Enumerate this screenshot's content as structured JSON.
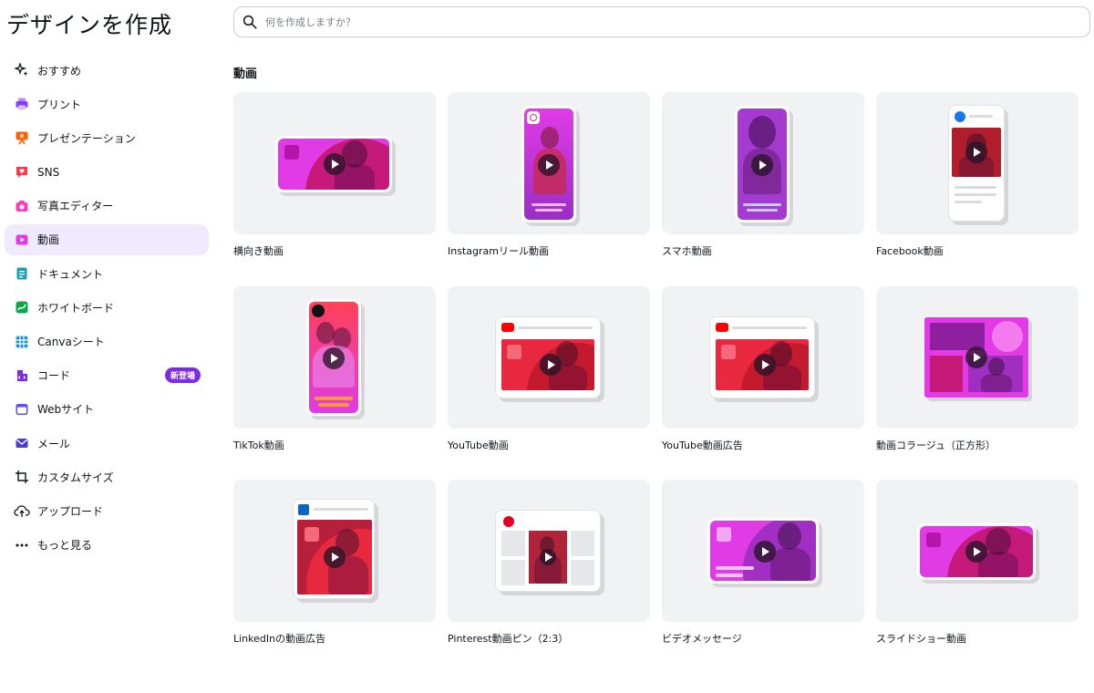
{
  "app": {
    "title": "デザインを作成"
  },
  "search": {
    "placeholder": "何を作成しますか？"
  },
  "sidebar": {
    "items": [
      {
        "label": "おすすめ",
        "icon": "sparkle-icon",
        "color": "#0e1318"
      },
      {
        "label": "プリント",
        "icon": "printer-icon",
        "color": "#8b3dff"
      },
      {
        "label": "プレゼンテーション",
        "icon": "presentation-icon",
        "color": "#ff6105"
      },
      {
        "label": "SNS",
        "icon": "heart-chat-icon",
        "color": "#ff3b4b"
      },
      {
        "label": "写真エディター",
        "icon": "camera-icon",
        "color": "#ff3bbc"
      },
      {
        "label": "動画",
        "icon": "video-icon",
        "color": "#e13be6",
        "active": true
      },
      {
        "label": "ドキュメント",
        "icon": "document-icon",
        "color": "#13a3b5"
      },
      {
        "label": "ホワイトボード",
        "icon": "whiteboard-icon",
        "color": "#0ba84a"
      },
      {
        "label": "Canvaシート",
        "icon": "sheet-icon",
        "color": "#1e90d6"
      },
      {
        "label": "コード",
        "icon": "code-icon",
        "color": "#7d2ae8",
        "badge": "新登場"
      },
      {
        "label": "Webサイト",
        "icon": "website-icon",
        "color": "#5a4bff"
      },
      {
        "label": "メール",
        "icon": "mail-icon",
        "color": "#4b3bcf"
      },
      {
        "label": "カスタムサイズ",
        "icon": "custom-size-icon",
        "color": "#0e1318"
      },
      {
        "label": "アップロード",
        "icon": "cloud-upload-icon",
        "color": "#0e1318"
      },
      {
        "label": "もっと見る",
        "icon": "more-icon",
        "color": "#0e1318"
      }
    ]
  },
  "main": {
    "section_title": "動画",
    "cards": [
      {
        "label": "横向き動画",
        "kind": "landscape"
      },
      {
        "label": "Instagramリール動画",
        "kind": "instagram"
      },
      {
        "label": "スマホ動画",
        "kind": "phone"
      },
      {
        "label": "Facebook動画",
        "kind": "facebook"
      },
      {
        "label": "TikTok動画",
        "kind": "tiktok"
      },
      {
        "label": "YouTube動画",
        "kind": "youtube"
      },
      {
        "label": "YouTube動画広告",
        "kind": "youtube"
      },
      {
        "label": "動画コラージュ（正方形）",
        "kind": "collage"
      },
      {
        "label": "LinkedInの動画広告",
        "kind": "linkedin"
      },
      {
        "label": "Pinterest動画ピン（2:3）",
        "kind": "pinterest"
      },
      {
        "label": "ビデオメッセージ",
        "kind": "message"
      },
      {
        "label": "スライドショー動画",
        "kind": "slideshow"
      }
    ]
  }
}
